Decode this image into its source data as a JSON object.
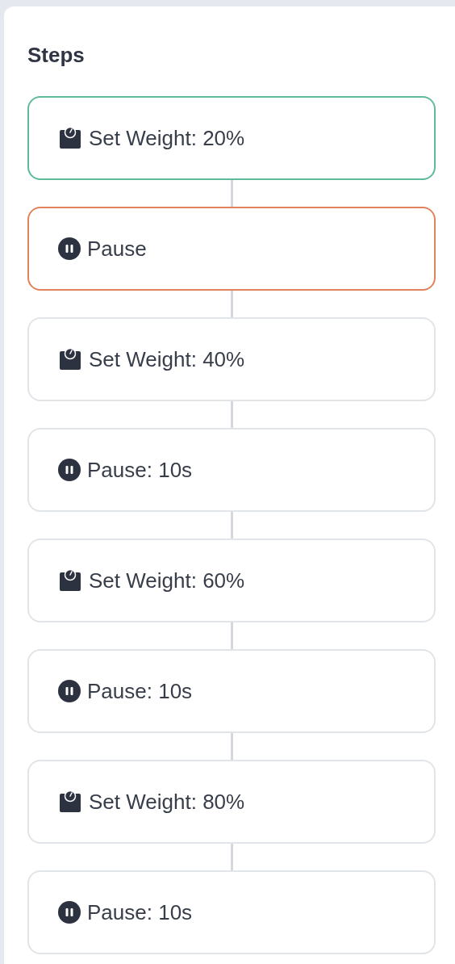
{
  "panel": {
    "title": "Steps"
  },
  "steps": [
    {
      "kind": "set_weight",
      "label": "Set Weight: 20%",
      "color": "#5fba97"
    },
    {
      "kind": "pause",
      "label": "Pause",
      "color": "#e0825a"
    },
    {
      "kind": "set_weight",
      "label": "Set Weight: 40%",
      "color": "#e1e4e8"
    },
    {
      "kind": "pause",
      "label": "Pause: 10s",
      "color": "#e1e4e8"
    },
    {
      "kind": "set_weight",
      "label": "Set Weight: 60%",
      "color": "#e1e4e8"
    },
    {
      "kind": "pause",
      "label": "Pause: 10s",
      "color": "#e1e4e8"
    },
    {
      "kind": "set_weight",
      "label": "Set Weight: 80%",
      "color": "#e1e4e8"
    },
    {
      "kind": "pause",
      "label": "Pause: 10s",
      "color": "#e1e4e8"
    }
  ]
}
